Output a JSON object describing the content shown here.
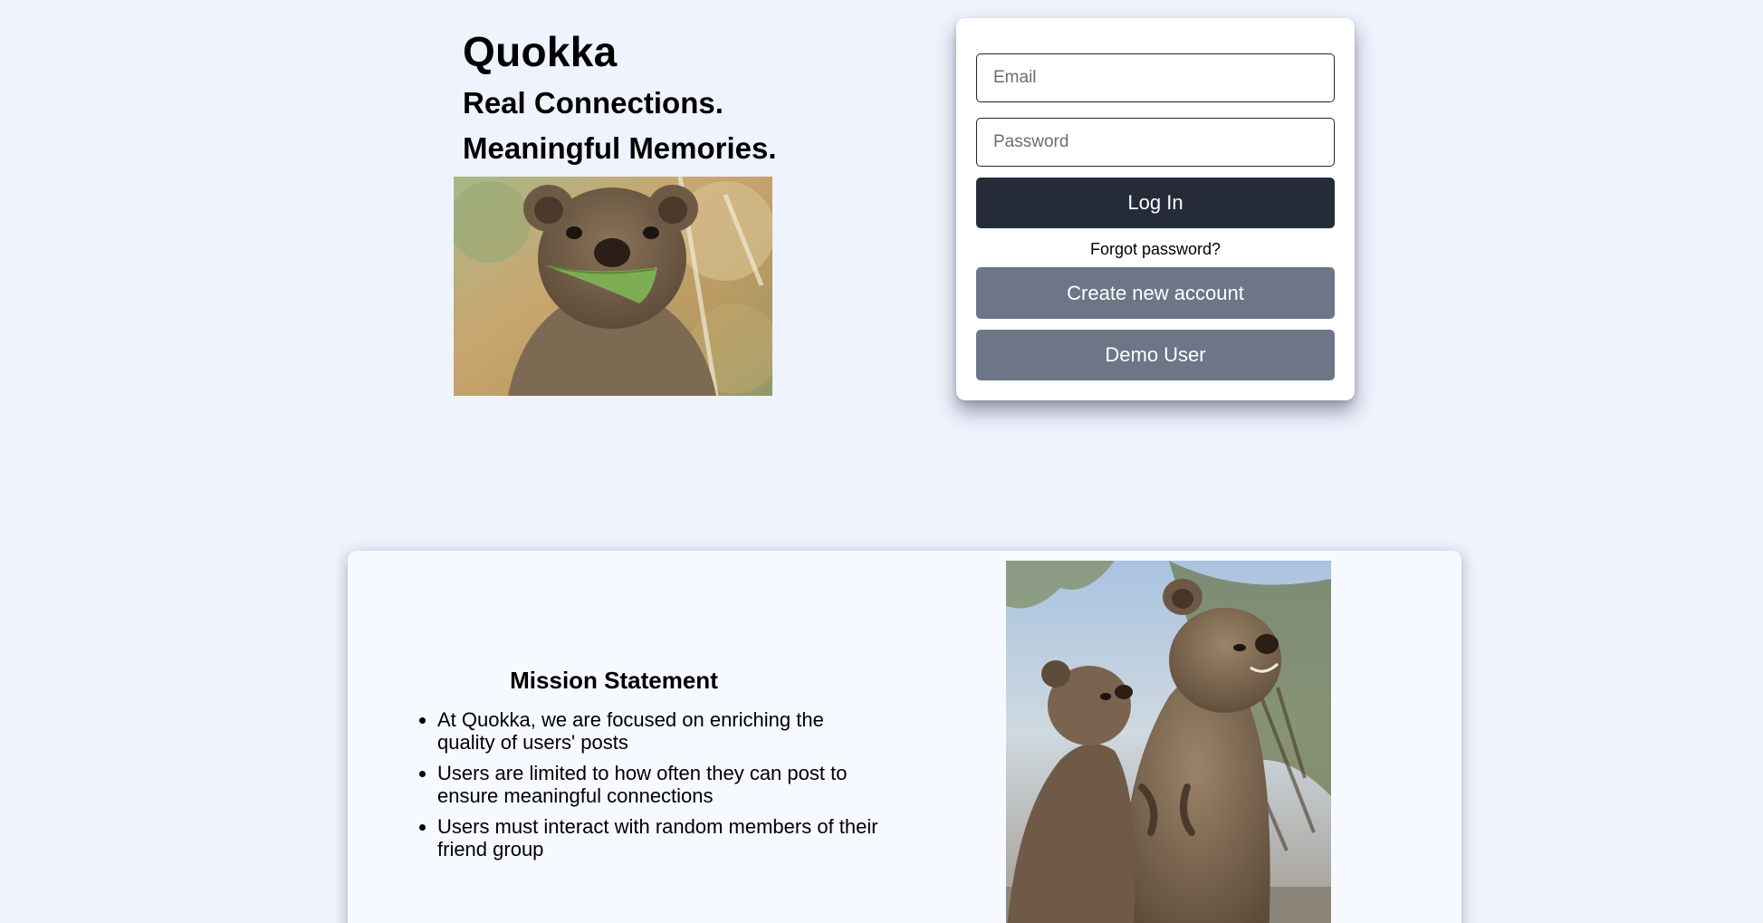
{
  "brand": {
    "title": "Quokka",
    "tagline_line1": "Real Connections.",
    "tagline_line2": "Meaningful Memories."
  },
  "hero_image": {
    "icon": "quokka-holding-leaf-photo"
  },
  "login": {
    "email_placeholder": "Email",
    "password_placeholder": "Password",
    "login_label": "Log In",
    "forgot_label": "Forgot password?",
    "create_label": "Create new account",
    "demo_label": "Demo User"
  },
  "mission": {
    "heading": "Mission Statement",
    "items": [
      "At Quokka, we are focused on enriching the quality of users' posts",
      "Users are limited to how often they can post to ensure meaningful connections",
      "Users must interact with random members of their friend group"
    ]
  },
  "panel_image": {
    "icon": "two-quokkas-photo"
  },
  "colors": {
    "page_background": "#eef3fe",
    "login_button": "#262b3a",
    "secondary_button": "#6c7686",
    "panel_background": "#f6f9ff"
  }
}
